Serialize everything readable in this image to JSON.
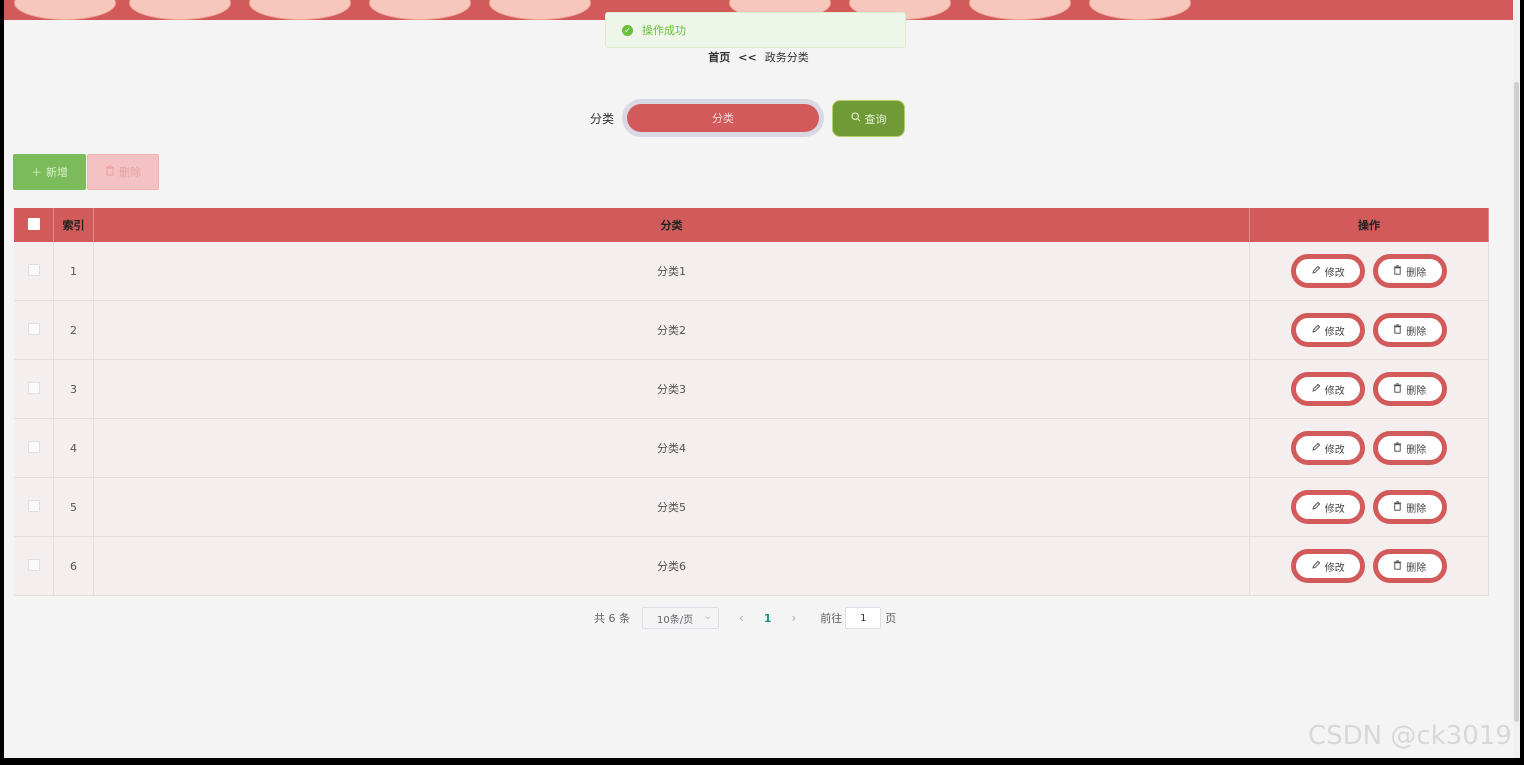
{
  "toast": {
    "message": "操作成功"
  },
  "breadcrumb": {
    "home": "首页",
    "separator": "<<",
    "current": "政务分类"
  },
  "search": {
    "label": "分类",
    "placeholder": "分类",
    "query_label": "查询"
  },
  "toolbar": {
    "add_label": "新增",
    "delete_label": "删除"
  },
  "table": {
    "headers": {
      "index": "索引",
      "category": "分类",
      "ops": "操作"
    },
    "rows": [
      {
        "index": "1",
        "category": "分类1"
      },
      {
        "index": "2",
        "category": "分类2"
      },
      {
        "index": "3",
        "category": "分类3"
      },
      {
        "index": "4",
        "category": "分类4"
      },
      {
        "index": "5",
        "category": "分类5"
      },
      {
        "index": "6",
        "category": "分类6"
      }
    ],
    "edit_label": "修改",
    "delete_label": "删除"
  },
  "pagination": {
    "total": "共 6 条",
    "page_size": "10条/页",
    "current_page": "1",
    "goto_label": "前往",
    "goto_value": "1",
    "page_unit": "页"
  },
  "watermark": "CSDN @ck3019",
  "colors": {
    "primary": "#d25a5a",
    "success": "#67c23a",
    "query": "#6f9a35",
    "add": "#7cbb5c",
    "delete_disabled": "#f4c2c2"
  }
}
